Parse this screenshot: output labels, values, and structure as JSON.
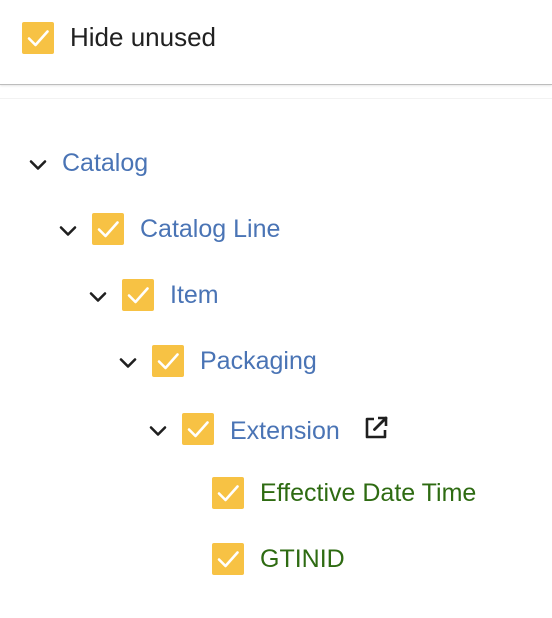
{
  "filter": {
    "hide_unused_label": "Hide unused",
    "hide_unused_checked": true
  },
  "colors": {
    "checkbox": "#f7c244",
    "node_link": "#4a74b5",
    "leaf_field": "#2e6b12"
  },
  "tree": {
    "catalog": {
      "label": "Catalog",
      "expanded": true
    },
    "catalog_line": {
      "label": "Catalog Line",
      "expanded": true,
      "checked": true
    },
    "item": {
      "label": "Item",
      "expanded": true,
      "checked": true
    },
    "packaging": {
      "label": "Packaging",
      "expanded": true,
      "checked": true
    },
    "extension": {
      "label": "Extension",
      "expanded": true,
      "checked": true,
      "icon": "external-link-icon"
    },
    "effective_date_time": {
      "label": "Effective Date Time",
      "checked": true
    },
    "gtinid": {
      "label": "GTINID",
      "checked": true
    }
  }
}
